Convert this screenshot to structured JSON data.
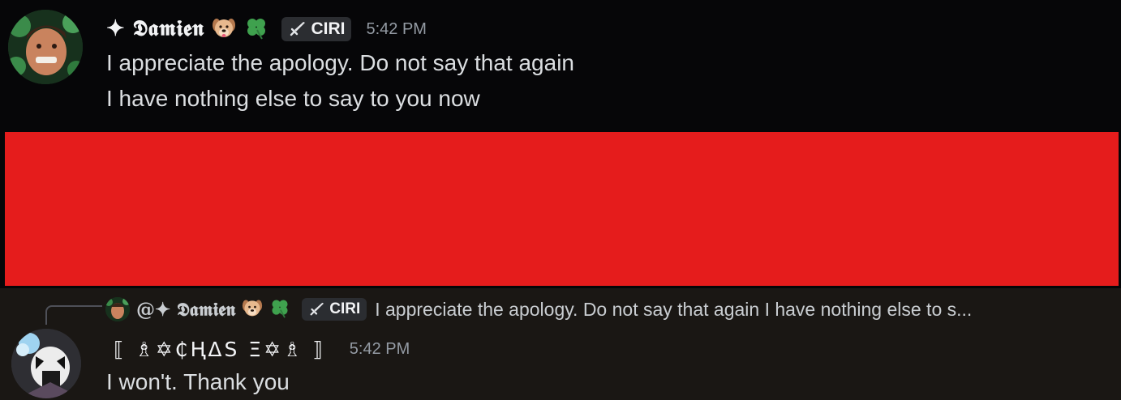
{
  "message1": {
    "username": "✦ 𝕯𝖆𝖒𝖎𝖊𝖓",
    "emoji1": "🐶",
    "emoji2": "🍀",
    "tag": "CIRI",
    "time": "5:42 PM",
    "lines": [
      "I appreciate the apology. Do not say that again",
      "I have nothing else to say to you now"
    ]
  },
  "reply": {
    "username": "@✦ 𝕯𝖆𝖒𝖎𝖊𝖓",
    "emoji1": "🐶",
    "emoji2": "🍀",
    "tag": "CIRI",
    "text": "I appreciate the apology. Do not say that again I have nothing else to s..."
  },
  "message2": {
    "username": "⟦ ♗✡₵ⱧΔS Ξ✡♗ ⟧",
    "time": "5:42 PM",
    "lines": [
      "I won't. Thank you"
    ]
  },
  "colors": {
    "redaction": "#e51c1c",
    "background_top": "#060608",
    "background_bottom": "#1a1714"
  },
  "icons": {
    "tag_icon": "sword-icon"
  }
}
